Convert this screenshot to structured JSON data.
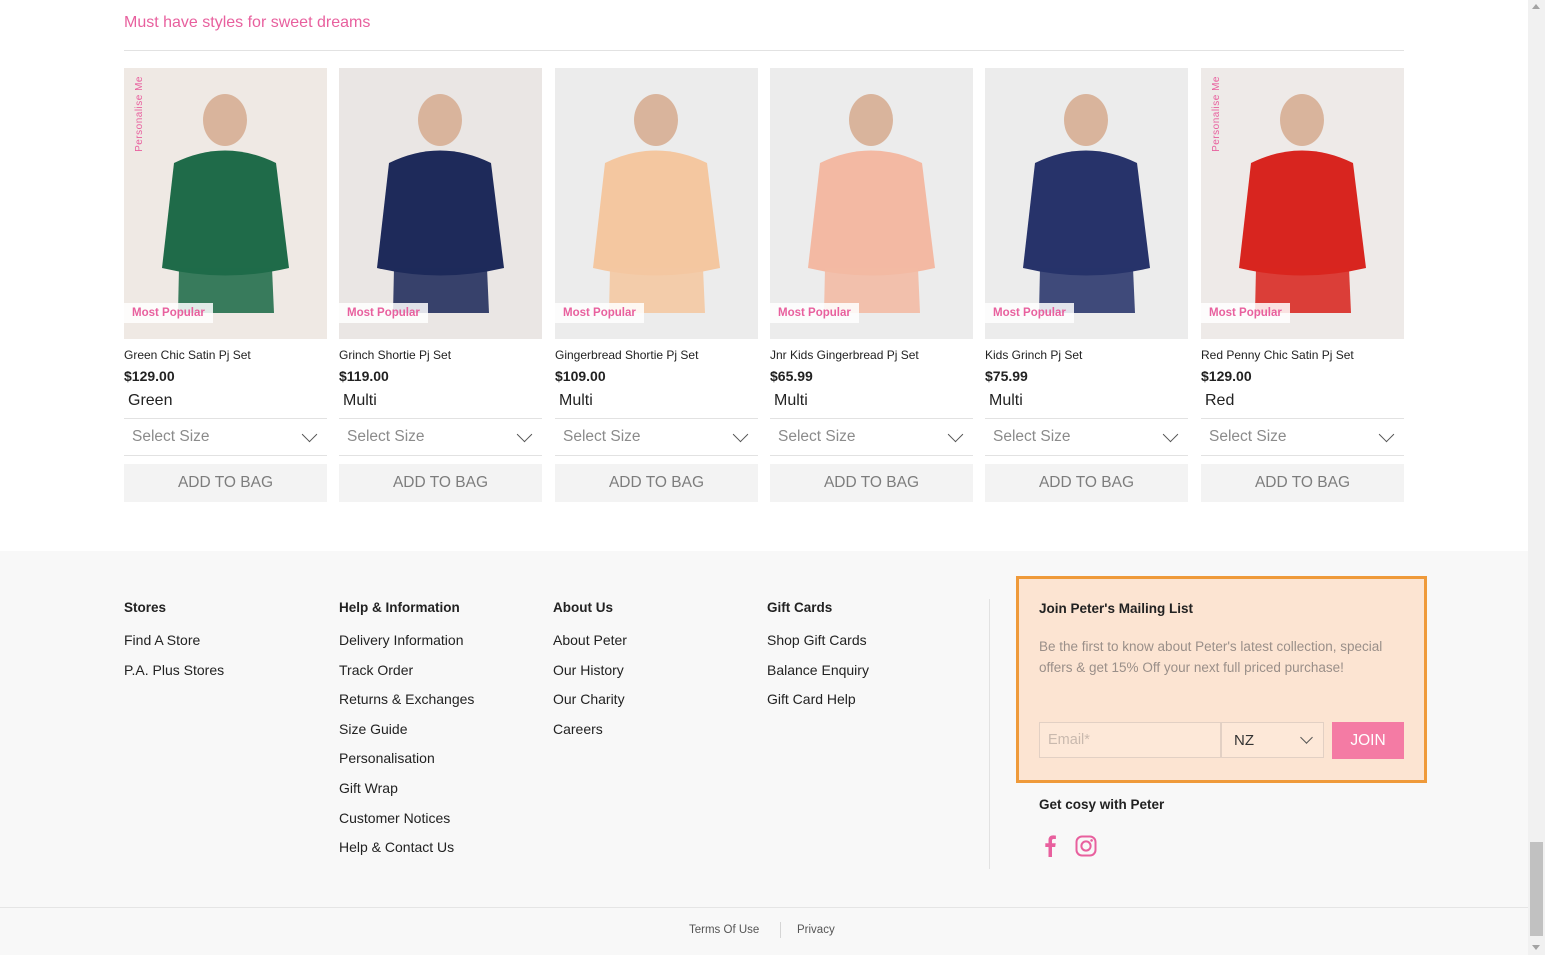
{
  "section": {
    "title": "Must have styles for sweet dreams"
  },
  "products": [
    {
      "name": "Green Chic Satin Pj Set",
      "price": "$129.00",
      "colour": "Green",
      "badge": "Most Popular",
      "personalise": "Personalise Me",
      "size_placeholder": "Select Size",
      "add_label": "ADD TO BAG",
      "swatch": "#1f6b49",
      "bg": "#efe9e4"
    },
    {
      "name": "Grinch Shortie Pj Set",
      "price": "$119.00",
      "colour": "Multi",
      "badge": "Most Popular",
      "personalise": "",
      "size_placeholder": "Select Size",
      "add_label": "ADD TO BAG",
      "swatch": "#1e2a5a",
      "bg": "#eae6e4"
    },
    {
      "name": "Gingerbread Shortie Pj Set",
      "price": "$109.00",
      "colour": "Multi",
      "badge": "Most Popular",
      "personalise": "",
      "size_placeholder": "Select Size",
      "add_label": "ADD TO BAG",
      "swatch": "#f4c7a0",
      "bg": "#ececec"
    },
    {
      "name": "Jnr Kids Gingerbread Pj Set",
      "price": "$65.99",
      "colour": "Multi",
      "badge": "Most Popular",
      "personalise": "",
      "size_placeholder": "Select Size",
      "add_label": "ADD TO BAG",
      "swatch": "#f3b9a3",
      "bg": "#ececec"
    },
    {
      "name": "Kids Grinch Pj Set",
      "price": "$75.99",
      "colour": "Multi",
      "badge": "Most Popular",
      "personalise": "",
      "size_placeholder": "Select Size",
      "add_label": "ADD TO BAG",
      "swatch": "#27336a",
      "bg": "#ececec"
    },
    {
      "name": "Red Penny Chic Satin Pj Set",
      "price": "$129.00",
      "colour": "Red",
      "badge": "Most Popular",
      "personalise": "Personalise Me",
      "size_placeholder": "Select Size",
      "add_label": "ADD TO BAG",
      "swatch": "#d8251f",
      "bg": "#eeeae8"
    }
  ],
  "footer": {
    "columns": [
      {
        "heading": "Stores",
        "links": [
          "Find A Store",
          "P.A. Plus Stores"
        ]
      },
      {
        "heading": "Help & Information",
        "links": [
          "Delivery Information",
          "Track Order",
          "Returns & Exchanges",
          "Size Guide",
          "Personalisation",
          "Gift Wrap",
          "Customer Notices",
          "Help & Contact Us"
        ]
      },
      {
        "heading": "About Us",
        "links": [
          "About Peter",
          "Our History",
          "Our Charity",
          "Careers"
        ]
      },
      {
        "heading": "Gift Cards",
        "links": [
          "Shop Gift Cards",
          "Balance Enquiry",
          "Gift Card Help"
        ]
      }
    ],
    "mailing": {
      "heading": "Join Peter's Mailing List",
      "description": "Be the first to know about Peter's latest collection, special offers & get 15% Off your next full priced purchase!",
      "email_placeholder": "Email*",
      "country": "NZ",
      "join_label": "JOIN"
    },
    "social_heading": "Get cosy with Peter",
    "social_icons": [
      "facebook-icon",
      "instagram-icon"
    ],
    "legal": {
      "terms": "Terms Of Use",
      "privacy": "Privacy"
    }
  },
  "colors": {
    "accent_pink": "#e8609e",
    "join_button": "#f47ba4",
    "mailing_bg": "#fce4d2",
    "mailing_border": "#ef9a3a"
  }
}
